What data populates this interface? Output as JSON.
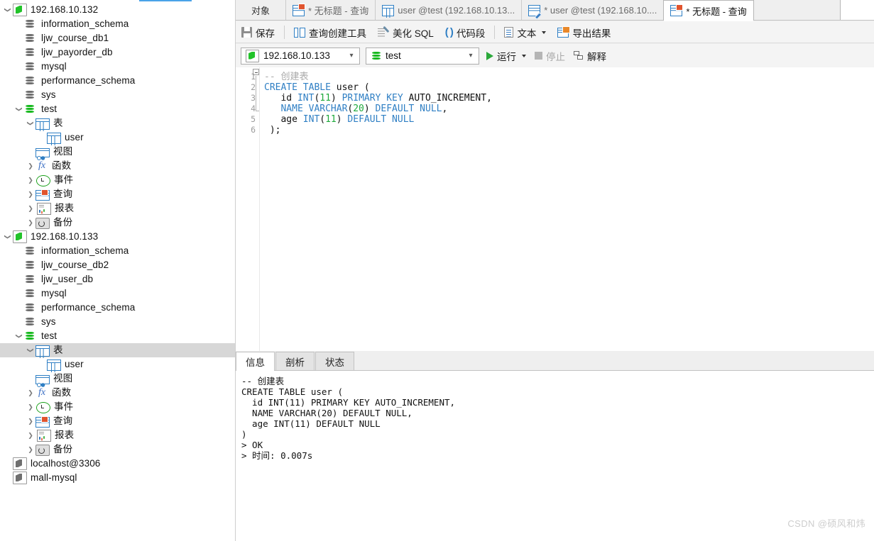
{
  "sidebar": {
    "tree": [
      {
        "indent": 0,
        "twist": "open",
        "icon": "connection-icon",
        "label": "192.168.10.132",
        "selected": false
      },
      {
        "indent": 1,
        "twist": "none",
        "icon": "database-icon",
        "label": "information_schema",
        "selected": false
      },
      {
        "indent": 1,
        "twist": "none",
        "icon": "database-icon",
        "label": "ljw_course_db1",
        "selected": false
      },
      {
        "indent": 1,
        "twist": "none",
        "icon": "database-icon",
        "label": "ljw_payorder_db",
        "selected": false
      },
      {
        "indent": 1,
        "twist": "none",
        "icon": "database-icon",
        "label": "mysql",
        "selected": false
      },
      {
        "indent": 1,
        "twist": "none",
        "icon": "database-icon",
        "label": "performance_schema",
        "selected": false
      },
      {
        "indent": 1,
        "twist": "none",
        "icon": "database-icon",
        "label": "sys",
        "selected": false
      },
      {
        "indent": 1,
        "twist": "open",
        "icon": "database-active-icon",
        "label": "test",
        "selected": false
      },
      {
        "indent": 2,
        "twist": "open",
        "icon": "table-folder-icon",
        "label": "表",
        "selected": false
      },
      {
        "indent": 3,
        "twist": "none",
        "icon": "table-icon",
        "label": "user",
        "selected": false
      },
      {
        "indent": 2,
        "twist": "none",
        "icon": "view-icon",
        "label": "视图",
        "selected": false
      },
      {
        "indent": 2,
        "twist": "closed",
        "icon": "function-icon",
        "label": "函数",
        "selected": false
      },
      {
        "indent": 2,
        "twist": "closed",
        "icon": "event-icon",
        "label": "事件",
        "selected": false
      },
      {
        "indent": 2,
        "twist": "closed",
        "icon": "query-icon",
        "label": "查询",
        "selected": false
      },
      {
        "indent": 2,
        "twist": "closed",
        "icon": "report-icon",
        "label": "报表",
        "selected": false
      },
      {
        "indent": 2,
        "twist": "closed",
        "icon": "backup-icon",
        "label": "备份",
        "selected": false
      },
      {
        "indent": 0,
        "twist": "open",
        "icon": "connection-icon",
        "label": "192.168.10.133",
        "selected": false
      },
      {
        "indent": 1,
        "twist": "none",
        "icon": "database-icon",
        "label": "information_schema",
        "selected": false
      },
      {
        "indent": 1,
        "twist": "none",
        "icon": "database-icon",
        "label": "ljw_course_db2",
        "selected": false
      },
      {
        "indent": 1,
        "twist": "none",
        "icon": "database-icon",
        "label": "ljw_user_db",
        "selected": false
      },
      {
        "indent": 1,
        "twist": "none",
        "icon": "database-icon",
        "label": "mysql",
        "selected": false
      },
      {
        "indent": 1,
        "twist": "none",
        "icon": "database-icon",
        "label": "performance_schema",
        "selected": false
      },
      {
        "indent": 1,
        "twist": "none",
        "icon": "database-icon",
        "label": "sys",
        "selected": false
      },
      {
        "indent": 1,
        "twist": "open",
        "icon": "database-active-icon",
        "label": "test",
        "selected": false
      },
      {
        "indent": 2,
        "twist": "open",
        "icon": "table-folder-icon",
        "label": "表",
        "selected": true
      },
      {
        "indent": 3,
        "twist": "none",
        "icon": "table-icon",
        "label": "user",
        "selected": false
      },
      {
        "indent": 2,
        "twist": "none",
        "icon": "view-icon",
        "label": "视图",
        "selected": false
      },
      {
        "indent": 2,
        "twist": "closed",
        "icon": "function-icon",
        "label": "函数",
        "selected": false
      },
      {
        "indent": 2,
        "twist": "closed",
        "icon": "event-icon",
        "label": "事件",
        "selected": false
      },
      {
        "indent": 2,
        "twist": "closed",
        "icon": "query-icon",
        "label": "查询",
        "selected": false
      },
      {
        "indent": 2,
        "twist": "closed",
        "icon": "report-icon",
        "label": "报表",
        "selected": false
      },
      {
        "indent": 2,
        "twist": "closed",
        "icon": "backup-icon",
        "label": "备份",
        "selected": false
      },
      {
        "indent": 0,
        "twist": "none",
        "icon": "connection-offline-icon",
        "label": "localhost@3306",
        "selected": false
      },
      {
        "indent": 0,
        "twist": "none",
        "icon": "connection-offline-icon",
        "label": "mall-mysql",
        "selected": false
      }
    ]
  },
  "tabbar": {
    "object_tab": "对象",
    "tabs": [
      {
        "label": "* 无标题 - 查询",
        "icon": "query-icon",
        "active": false
      },
      {
        "label": "user @test (192.168.10.13...",
        "icon": "table-icon",
        "active": false
      },
      {
        "label": "* user @test (192.168.10....",
        "icon": "table-edit-icon",
        "active": false
      },
      {
        "label": "* 无标题 - 查询",
        "icon": "query-icon",
        "active": true
      }
    ]
  },
  "toolbar": {
    "save_label": "保存",
    "query_builder_label": "查询创建工具",
    "beautify_label": "美化 SQL",
    "snippet_label": "代码段",
    "text_label": "文本",
    "export_label": "导出结果"
  },
  "selector": {
    "connection_value": "192.168.10.133",
    "database_value": "test",
    "run_label": "运行",
    "stop_label": "停止",
    "explain_label": "解释"
  },
  "editor": {
    "line_numbers": [
      "1",
      "2",
      "3",
      "4",
      "5",
      "6"
    ],
    "lines": [
      {
        "n": 1,
        "segments": [
          {
            "t": "-- 创建表",
            "c": "cmt"
          }
        ]
      },
      {
        "n": 2,
        "segments": [
          {
            "t": "CREATE TABLE ",
            "c": "kw"
          },
          {
            "t": "user",
            "c": "id"
          },
          {
            "t": " (",
            "c": "id"
          }
        ]
      },
      {
        "n": 3,
        "segments": [
          {
            "t": "   id ",
            "c": "id"
          },
          {
            "t": "INT",
            "c": "kw"
          },
          {
            "t": "(",
            "c": "id"
          },
          {
            "t": "11",
            "c": "num"
          },
          {
            "t": ") ",
            "c": "id"
          },
          {
            "t": "PRIMARY KEY",
            "c": "kw"
          },
          {
            "t": " AUTO_INCREMENT,",
            "c": "id"
          }
        ]
      },
      {
        "n": 4,
        "segments": [
          {
            "t": "   ",
            "c": "id"
          },
          {
            "t": "NAME VARCHAR",
            "c": "kw"
          },
          {
            "t": "(",
            "c": "id"
          },
          {
            "t": "20",
            "c": "num"
          },
          {
            "t": ") ",
            "c": "id"
          },
          {
            "t": "DEFAULT NULL",
            "c": "kw"
          },
          {
            "t": ",",
            "c": "id"
          }
        ]
      },
      {
        "n": 5,
        "segments": [
          {
            "t": "   age ",
            "c": "id"
          },
          {
            "t": "INT",
            "c": "kw"
          },
          {
            "t": "(",
            "c": "id"
          },
          {
            "t": "11",
            "c": "num"
          },
          {
            "t": ") ",
            "c": "id"
          },
          {
            "t": "DEFAULT NULL",
            "c": "kw"
          }
        ]
      },
      {
        "n": 6,
        "segments": [
          {
            "t": " );",
            "c": "id"
          }
        ]
      }
    ]
  },
  "results": {
    "tabs": [
      {
        "label": "信息",
        "active": true
      },
      {
        "label": "剖析",
        "active": false
      },
      {
        "label": "状态",
        "active": false
      }
    ],
    "log": "-- 创建表\nCREATE TABLE user (\n  id INT(11) PRIMARY KEY AUTO_INCREMENT,\n  NAME VARCHAR(20) DEFAULT NULL,\n  age INT(11) DEFAULT NULL\n)\n> OK\n> 时间: 0.007s"
  },
  "watermark": "CSDN @硕风和炜",
  "colors": {
    "accent": "#2f7fc4",
    "run_green": "#2aa83a",
    "selection": "#d7d7d7"
  }
}
